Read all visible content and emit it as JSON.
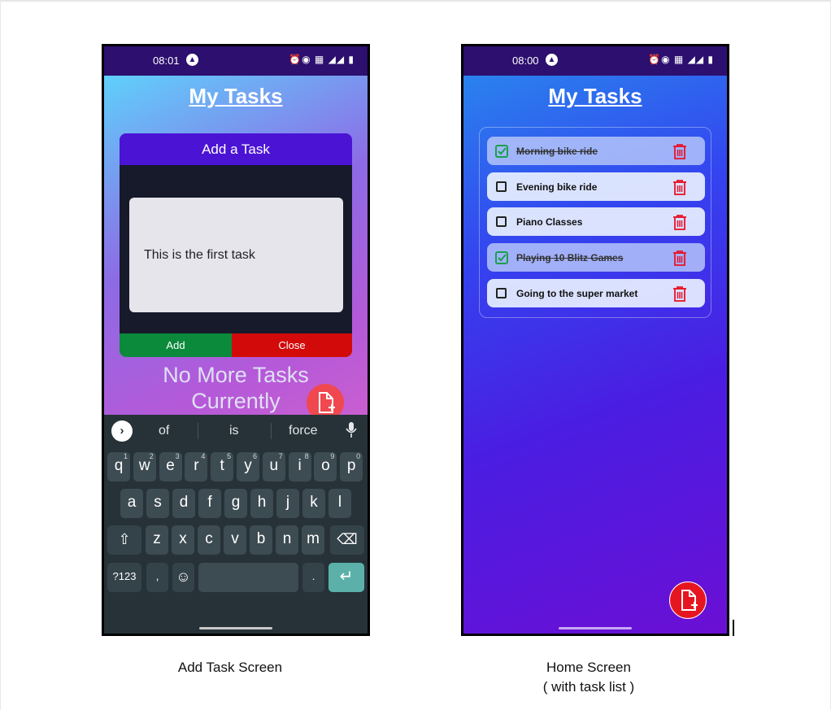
{
  "add_screen": {
    "status_time": "08:01",
    "title": "My Tasks",
    "modal_title": "Add a Task",
    "input_value": "This is the first task",
    "add_label": "Add",
    "close_label": "Close",
    "empty_line1": "No More Tasks",
    "empty_line2": "Currently",
    "keyboard": {
      "suggestions": [
        "of",
        "is",
        "force"
      ],
      "row1": [
        "q",
        "w",
        "e",
        "r",
        "t",
        "y",
        "u",
        "i",
        "o",
        "p"
      ],
      "row1_sup": [
        "1",
        "2",
        "3",
        "4",
        "5",
        "6",
        "7",
        "8",
        "9",
        "0"
      ],
      "row2": [
        "a",
        "s",
        "d",
        "f",
        "g",
        "h",
        "j",
        "k",
        "l"
      ],
      "row3": [
        "z",
        "x",
        "c",
        "v",
        "b",
        "n",
        "m"
      ],
      "symbols_label": "?123",
      "comma": ",",
      "period": "."
    }
  },
  "home_screen": {
    "status_time": "08:00",
    "title": "My Tasks",
    "tasks": [
      {
        "text": "Morning bike ride",
        "done": true
      },
      {
        "text": "Evening bike ride",
        "done": false
      },
      {
        "text": "Piano Classes",
        "done": false
      },
      {
        "text": "Playing 10 Blitz Games",
        "done": true
      },
      {
        "text": "Going to the super market",
        "done": false
      }
    ]
  },
  "captions": {
    "left": "Add Task Screen",
    "right_line1": "Home Screen",
    "right_line2": "( with task list )"
  },
  "colors": {
    "modal_header": "#4b13d4",
    "add_button": "#0b8a3b",
    "close_button": "#d20a0a",
    "fab": "#e51620",
    "check_green": "#1aa04a",
    "trash_red": "#e8142a"
  }
}
